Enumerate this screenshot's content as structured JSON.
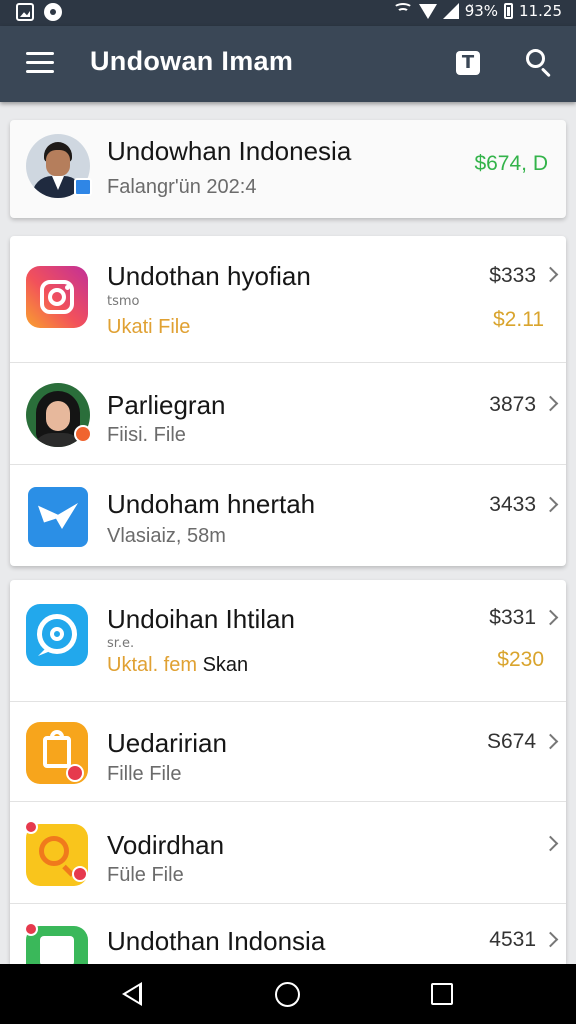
{
  "status_bar": {
    "battery": "9̃3%",
    "time": "11.25"
  },
  "app_bar": {
    "title": "Undowan Imam",
    "t_icon_label": "T"
  },
  "top_card": {
    "title": "Undowhan Indonesia",
    "subtitle": "Falangr'ün 202:4",
    "amount": "$674, D",
    "amount_color": "#33b34a"
  },
  "group1": [
    {
      "title": "Undothan hyofian",
      "tiny": "tsmo",
      "subtitle": "Ukati File",
      "subtitle_color": "orange",
      "price": "$333",
      "price2": "$2.11",
      "icon": "instagram-icon"
    },
    {
      "title": "Parliegran",
      "subtitle": "Fiisi. File",
      "price": "3873",
      "icon": "avatar-woman"
    },
    {
      "title": "Undoham hnertah",
      "subtitle": "Vlasiaiz, 58m",
      "price": "3433",
      "icon": "blue-envelope-icon"
    }
  ],
  "group2": [
    {
      "title": "Undoihan Ihtilan",
      "tiny": "sr.e.",
      "subtitle_part1": "Uktal. fem",
      "subtitle_part2": "Skan",
      "price": "$331",
      "price2": "$230",
      "icon": "chat-bubble-icon"
    },
    {
      "title": "Uedaririan",
      "subtitle": "Fille File",
      "price": "S674",
      "icon": "shopping-bag-icon"
    },
    {
      "title": "Vodirdhan",
      "subtitle": "Füle File",
      "price": "",
      "icon": "magnifier-app-icon"
    },
    {
      "title": "Undothan Indonsia",
      "subtitle": "",
      "price": "4531",
      "icon": "green-app-icon"
    }
  ],
  "colors": {
    "status_bar": "#2d3744",
    "app_bar": "#3a4756",
    "green": "#33b34a",
    "orange": "#e0a133",
    "gold": "#d9a42d"
  }
}
